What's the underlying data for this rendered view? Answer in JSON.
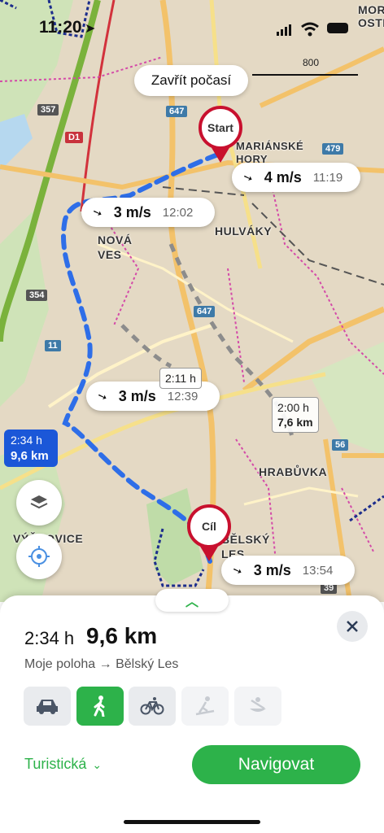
{
  "status_bar": {
    "time": "11:20"
  },
  "map": {
    "weather_button": "Zavřít počasí",
    "places": [
      "Start",
      "MARIÁNSKÉ HORY",
      "HULVÁKY",
      "NOVÁ VES",
      "HRABŮVKA",
      "VÝŠKOVICE",
      "BĚLSKÝ LES",
      "MOR OSTR"
    ],
    "roads": [
      "357",
      "D1",
      "647",
      "479",
      "354",
      "11",
      "56",
      "39"
    ],
    "scale": "800",
    "start_label": "Start",
    "end_label": "Cíl",
    "wind_chips": [
      {
        "speed": "4 m/s",
        "time": "11:19"
      },
      {
        "speed": "3 m/s",
        "time": "12:02"
      },
      {
        "speed": "3 m/s",
        "time": "12:39"
      },
      {
        "speed": "3 m/s",
        "time": "13:54"
      }
    ],
    "route_label": {
      "time": "2:34 h",
      "distance": "9,6 km"
    },
    "alt_route_label": {
      "time": "2:00 h",
      "distance": "7,6 km"
    },
    "alt_route_label2": {
      "time": "2:11 h"
    }
  },
  "sheet": {
    "duration": "2:34 h",
    "distance": "9,6 km",
    "route_desc": "Moje poloha → Bělský Les",
    "modes": [
      {
        "name": "car",
        "state": "normal"
      },
      {
        "name": "walk",
        "state": "active"
      },
      {
        "name": "bike",
        "state": "normal"
      },
      {
        "name": "ski",
        "state": "disabled"
      },
      {
        "name": "boat",
        "state": "disabled"
      }
    ],
    "route_type": "Turistická",
    "navigate_button": "Navigovat",
    "colors": {
      "accent": "#2db24a",
      "route": "#1b57d8",
      "pin": "#c8102e"
    }
  }
}
